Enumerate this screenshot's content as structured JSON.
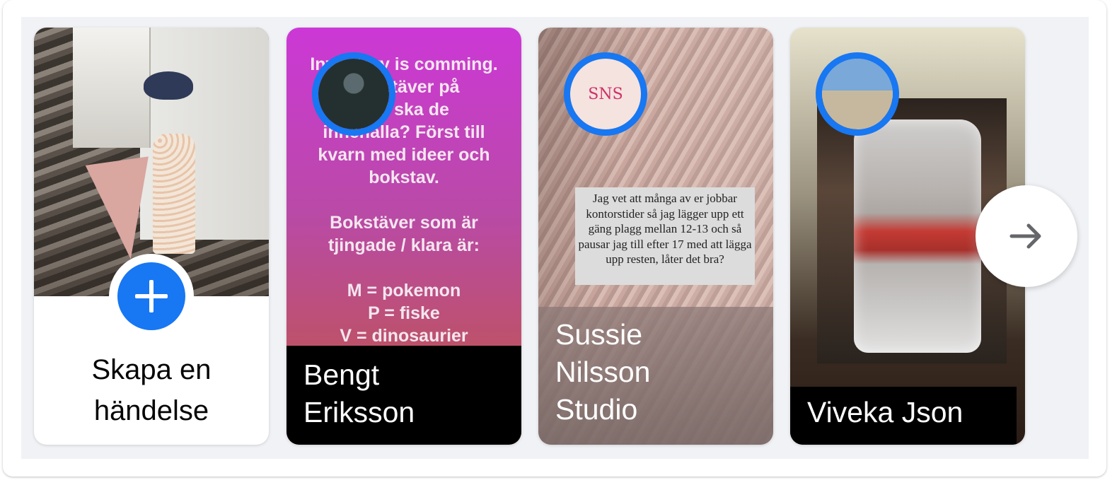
{
  "create_card": {
    "label": "Skapa en\nhändelse",
    "icon": "plus-icon"
  },
  "stories": [
    {
      "name": "Bengt\nEriksson",
      "text": "Inventory is comming.\nBokstäver på\nvad ska de\ninnehalla? Först till\nkvarn med ideer och\nbokstav.\n\nBokstäver som är\ntjingade / klara är:\n\nM = pokemon\nP = fiske\nV = dinosaurier"
    },
    {
      "name": "Sussie\nNilsson\nStudio",
      "avatar_text": "SNS",
      "quote": "Jag vet att många av er jobbar kontorstider så jag lägger upp ett gäng plagg mellan 12-13 och så pausar jag till efter 17 med att lägga upp resten, låter det bra?"
    },
    {
      "name": "Viveka Json"
    }
  ],
  "next_button": {
    "icon": "arrow-right-icon"
  },
  "colors": {
    "accent": "#1877f2",
    "background": "#f0f2f5"
  }
}
